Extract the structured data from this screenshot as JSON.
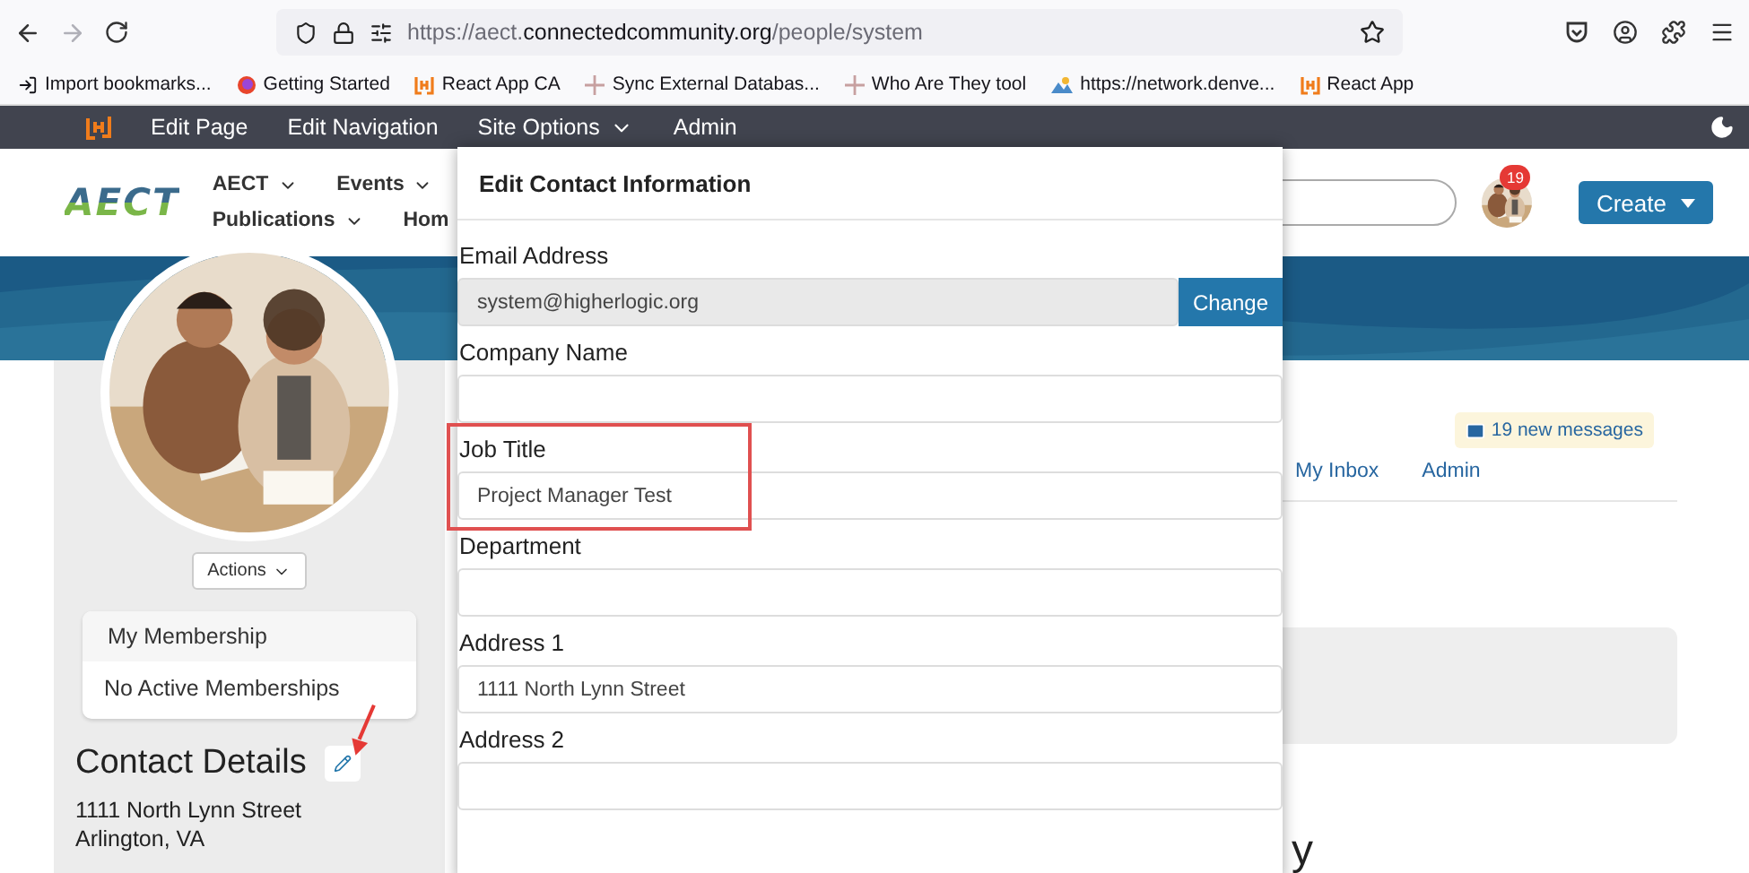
{
  "browser": {
    "url_prefix": "https://aect.",
    "url_domain": "connectedcommunity.org",
    "url_path": "/people/system",
    "bookmarks": [
      {
        "label": "Import bookmarks...",
        "kind": "import"
      },
      {
        "label": "Getting Started",
        "kind": "firefox"
      },
      {
        "label": "React App CA",
        "kind": "brand"
      },
      {
        "label": "Sync External Databas...",
        "kind": "plain"
      },
      {
        "label": "Who Are They tool",
        "kind": "plain"
      },
      {
        "label": "https://network.denve...",
        "kind": "site"
      },
      {
        "label": "React App",
        "kind": "brand"
      }
    ]
  },
  "admin_bar": {
    "items": [
      {
        "label": "Edit Page",
        "dropdown": false
      },
      {
        "label": "Edit Navigation",
        "dropdown": false
      },
      {
        "label": "Site Options",
        "dropdown": true
      },
      {
        "label": "Admin",
        "dropdown": false
      }
    ]
  },
  "site_header": {
    "logo": "AECT",
    "nav_rows": [
      [
        {
          "label": "AECT",
          "dropdown": true
        },
        {
          "label": "Events",
          "dropdown": true
        }
      ],
      [
        {
          "label": "Publications",
          "dropdown": true
        },
        {
          "label": "Hom",
          "dropdown": false
        }
      ]
    ],
    "notification_count": "19",
    "create_button": "Create"
  },
  "profile": {
    "actions_button": "Actions",
    "membership_title": "My Membership",
    "membership_status": "No Active Memberships",
    "contact_heading": "Contact Details",
    "address_lines": [
      "1111 North Lynn Street",
      "Arlington, VA"
    ]
  },
  "main": {
    "messages_badge": "19 new messages",
    "tabs": [
      {
        "label": "My Inbox",
        "selected": false
      },
      {
        "label": "Admin",
        "selected": false
      }
    ],
    "heading_fragment": "y"
  },
  "modal": {
    "title": "Edit Contact Information",
    "fields": [
      {
        "label": "Email Address",
        "kind": "locked",
        "value": "system@higherlogic.org",
        "button": "Change",
        "highlighted": false
      },
      {
        "label": "Company Name",
        "kind": "text",
        "highlighted": false
      },
      {
        "label": "Job Title",
        "kind": "text",
        "value": "Project Manager Test",
        "highlighted": true
      },
      {
        "label": "Department",
        "kind": "text",
        "highlighted": false
      },
      {
        "label": "Address 1",
        "kind": "text",
        "value": "1111 North Lynn Street",
        "highlighted": false
      },
      {
        "label": "Address 2",
        "kind": "text",
        "highlighted": false
      }
    ]
  }
}
